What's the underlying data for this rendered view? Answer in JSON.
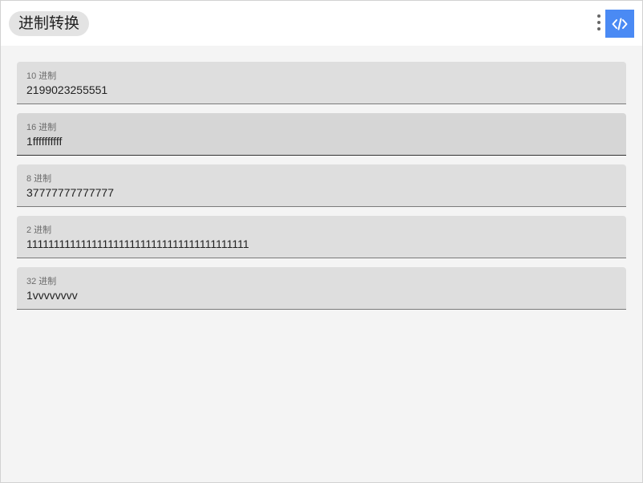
{
  "app": {
    "title": "进制转换"
  },
  "toolbar": {
    "more_icon": "more-vertical-icon",
    "code_icon": "code-icon",
    "accent_color": "#4a8af4"
  },
  "fields": [
    {
      "label": "10 进制",
      "value": "2199023255551"
    },
    {
      "label": "16 进制",
      "value": "1ffffffffff"
    },
    {
      "label": "8 进制",
      "value": "37777777777777"
    },
    {
      "label": "2 进制",
      "value": "11111111111111111111111111111111111111111"
    },
    {
      "label": "32 进制",
      "value": "1vvvvvvvv"
    }
  ]
}
